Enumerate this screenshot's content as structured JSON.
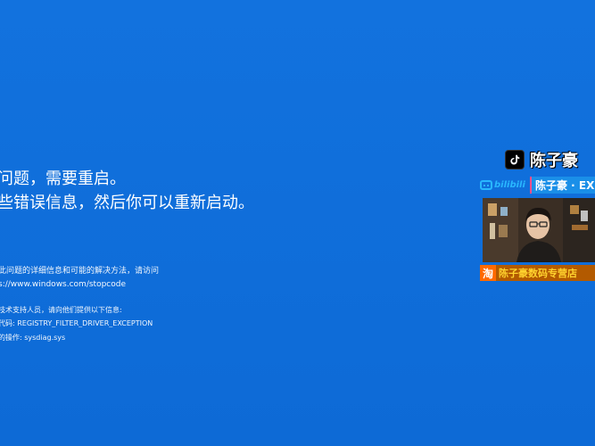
{
  "bsod": {
    "line1": "问题，需要重启。",
    "line2": "些错误信息，然后你可以重新启动。",
    "info_line1": "此问题的详细信息和可能的解决方法，请访问",
    "info_line2": "s://www.windows.com/stopcode",
    "support_line": "技术支持人员，请向他们提供以下信息:",
    "stop_code_line": "代码: REGISTRY_FILTER_DRIVER_EXCEPTION",
    "failed_line": "的操作: sysdiag.sys"
  },
  "overlay": {
    "tiktok_icon": "tiktok-icon",
    "tiktok_name": "陈子豪",
    "bili_logo_text": "bilibili",
    "bili_name": "陈子豪 · EX",
    "shop_icon_text": "淘",
    "shop_text": "陈子豪数码专营店"
  },
  "colors": {
    "background": "#0f6fda",
    "text": "#ffffff",
    "bili_accent": "#29b7ff",
    "shop_orange": "#ff6a00",
    "shop_text": "#ffd22e"
  }
}
